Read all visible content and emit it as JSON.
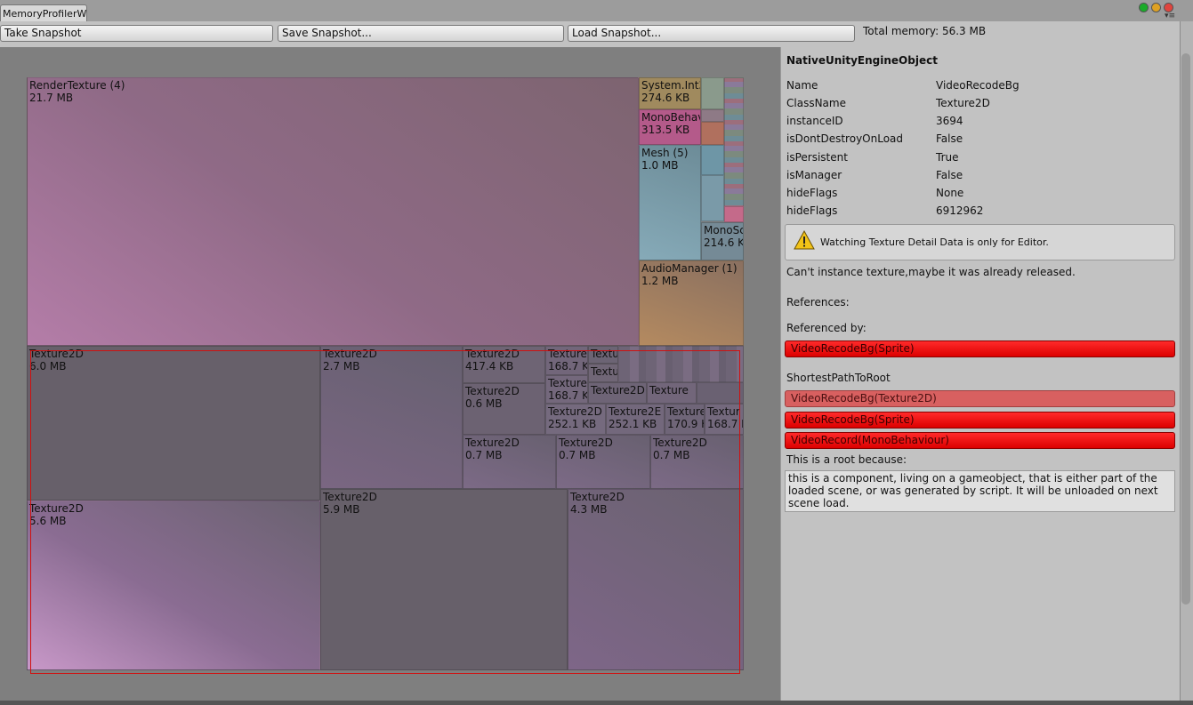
{
  "window": {
    "tab_title": "MemoryProfilerW",
    "colors": {
      "close": "#e0443e",
      "minimize": "#dea123",
      "maximize": "#1aab29"
    }
  },
  "toolbar": {
    "take_snapshot": "Take Snapshot",
    "save_snapshot": "Save Snapshot...",
    "load_snapshot": "Load Snapshot...",
    "total_memory": "Total memory: 56.3 MB"
  },
  "treemap": {
    "groups": [
      {
        "name": "RenderTexture (4)",
        "size": "21.7 MB"
      },
      {
        "name": "System.Int3",
        "size": "274.6 KB"
      },
      {
        "name": "MonoBehav",
        "size": "313.5 KB"
      },
      {
        "name": "Mesh (5)",
        "size": "1.0 MB"
      },
      {
        "name": "MonoSc",
        "size": "214.6 K"
      },
      {
        "name": "AudioManager (1)",
        "size": "1.2 MB"
      }
    ],
    "textures": [
      {
        "name": "Texture2D",
        "size": "6.0 MB"
      },
      {
        "name": "Texture2D",
        "size": "2.7 MB"
      },
      {
        "name": "Texture2D",
        "size": "417.4 KB"
      },
      {
        "name": "Texture",
        "size": "168.7 K"
      },
      {
        "name": "Textu",
        "size": ""
      },
      {
        "name": "Textu",
        "size": ""
      },
      {
        "name": "Texture2D",
        "size": "0.6 MB"
      },
      {
        "name": "Texture",
        "size": "168.7 K"
      },
      {
        "name": "Texture2D",
        "size": ""
      },
      {
        "name": "Texture",
        "size": ""
      },
      {
        "name": "Texture2D",
        "size": "252.1 KB"
      },
      {
        "name": "Texture2E",
        "size": "252.1 KB"
      },
      {
        "name": "Texture",
        "size": "170.9 K"
      },
      {
        "name": "Textur",
        "size": "168.7 K"
      },
      {
        "name": "Texture2D",
        "size": "0.7 MB"
      },
      {
        "name": "Texture2D",
        "size": "0.7 MB"
      },
      {
        "name": "Texture2D",
        "size": "0.7 MB"
      },
      {
        "name": "Texture2D",
        "size": "5.6 MB"
      },
      {
        "name": "Texture2D",
        "size": "5.9 MB"
      },
      {
        "name": "Texture2D",
        "size": "4.3 MB"
      }
    ]
  },
  "inspector": {
    "header": "NativeUnityEngineObject",
    "properties": [
      {
        "name": "Name",
        "value": "VideoRecodeBg"
      },
      {
        "name": "ClassName",
        "value": "Texture2D"
      },
      {
        "name": "instanceID",
        "value": "3694"
      },
      {
        "name": "isDontDestroyOnLoad",
        "value": "False"
      },
      {
        "name": "isPersistent",
        "value": "True"
      },
      {
        "name": "isManager",
        "value": "False"
      },
      {
        "name": "hideFlags",
        "value": "None"
      },
      {
        "name": "hideFlags",
        "value": "6912962"
      }
    ],
    "warning": "Watching Texture Detail Data is only for Editor.",
    "cant_instance": "Can't instance texture,maybe it was already released.",
    "references_label": "References:",
    "referenced_by_label": "Referenced by:",
    "referenced_by": [
      "VideoRecodeBg(Sprite)"
    ],
    "shortest_path_label": "ShortestPathToRoot",
    "shortest_path": [
      "VideoRecodeBg(Texture2D)",
      "VideoRecodeBg(Sprite)",
      "VideoRecord(MonoBehaviour)"
    ],
    "root_reason_label": "This is a root because:",
    "root_reason": "this is a component, living on a gameobject, that is either part of the loaded scene, or was generated by script. It will be unloaded on next scene load."
  }
}
